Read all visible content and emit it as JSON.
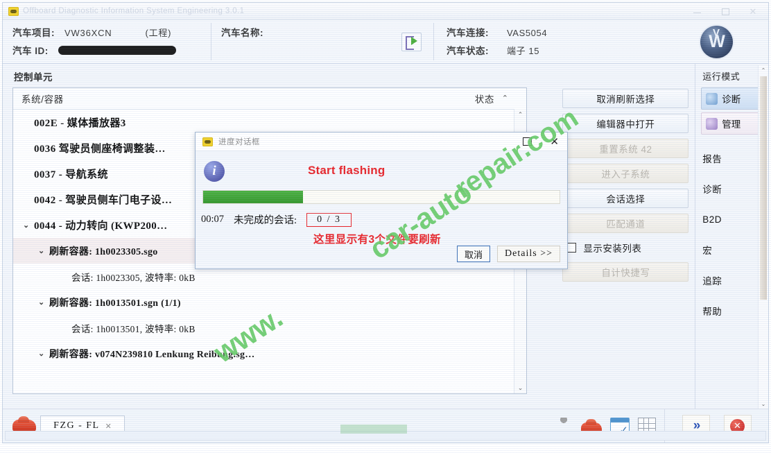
{
  "window": {
    "title": "Offboard Diagnostic Information System Engineering  3.0.1",
    "minimize": "–",
    "maximize": "□",
    "close": "✕"
  },
  "header": {
    "project_label": "汽车项目:",
    "project_value": "VW36XCN",
    "project_mode": "(工程)",
    "id_label": "汽车 ID:",
    "id_value": "",
    "name_label": "汽车名称:",
    "name_value": "",
    "connection_label": "汽车连接:",
    "connection_value": "VAS5054",
    "state_label": "汽车状态:",
    "state_value": "端子 15",
    "brand_logo": "vw-logo"
  },
  "main": {
    "section_title": "控制单元",
    "columns": {
      "system": "系统/容器",
      "status": "状态",
      "sort": "⌃"
    },
    "tree": [
      {
        "level": 1,
        "caret": "",
        "text": "002E - 媒体播放器3",
        "selected": false
      },
      {
        "level": 1,
        "caret": "",
        "text": "0036    驾驶员侧座椅调整装…",
        "selected": false
      },
      {
        "level": 1,
        "caret": "",
        "text": "0037 - 导航系统",
        "selected": false
      },
      {
        "level": 1,
        "caret": "",
        "text": "0042 - 驾驶员侧车门电子设…",
        "selected": false
      },
      {
        "level": 1,
        "caret": "⌄",
        "text": "0044 - 动力转向  (KWP200…",
        "selected": false
      },
      {
        "level": 2,
        "caret": "⌄",
        "text": "刷新容器: 1h0023305.sgo",
        "selected": true
      },
      {
        "level": 3,
        "caret": "",
        "text": "会话: 1h0023305, 波特率: 0kB",
        "selected": false
      },
      {
        "level": 2,
        "caret": "⌄",
        "text": "刷新容器: 1h0013501.sgn (1/1)",
        "selected": false
      },
      {
        "level": 3,
        "caret": "",
        "text": "会话: 1h0013501, 波特率: 0kB",
        "selected": false
      },
      {
        "level": 2,
        "caret": "⌄",
        "text": "刷新容器: v074N239810   Lenkung Reibung.sg…",
        "selected": false
      }
    ],
    "scroll": {
      "up": "⌃",
      "down": "⌄"
    }
  },
  "actions": {
    "buttons": [
      {
        "label": "取消刷新选择",
        "disabled": false
      },
      {
        "label": "编辑器中打开",
        "disabled": false
      },
      {
        "label": "重置系统 42",
        "disabled": true
      },
      {
        "label": "进入子系统",
        "disabled": true
      },
      {
        "label": "会话选择",
        "disabled": false
      },
      {
        "label": "匹配通道",
        "disabled": true
      }
    ],
    "checkbox": {
      "label": "显示安装列表",
      "checked": false
    },
    "bottom_button": {
      "label": "自计快捷写",
      "disabled": true
    }
  },
  "sidebar": {
    "mode_header": {
      "label": "运行模式",
      "chevron": "⌃"
    },
    "mode_buttons": [
      {
        "label": "诊断",
        "icon": "diagnosis-icon",
        "active": true
      },
      {
        "label": "管理",
        "icon": "admin-icon",
        "active": false
      }
    ],
    "items": [
      {
        "label": "报告",
        "chevron": "⌄"
      },
      {
        "label": "诊断",
        "chevron": "⌄"
      },
      {
        "label": "B2D",
        "chevron": "⌄"
      },
      {
        "label": "宏",
        "chevron": "⌄"
      },
      {
        "label": "追踪",
        "chevron": "⌄"
      },
      {
        "label": "帮助",
        "chevron": "⌄"
      }
    ],
    "scroll": {
      "up": "⌃",
      "down": "⌄"
    }
  },
  "dialog": {
    "title": "进度对话框",
    "maximize": "□",
    "close": "✕",
    "annotation_en": "Start flashing",
    "annotation_cn": "这里显示有3个文件要刷新",
    "progress_percent": 28,
    "elapsed": "00:07",
    "progress_label": "未完成的会话:",
    "progress_count": "0 / 3",
    "cancel_button": "取消",
    "details_button": "Details >>"
  },
  "footer": {
    "tab": {
      "label": "FZG - FL",
      "close": "✕",
      "icon": "car-icon"
    },
    "tools": [
      {
        "name": "puzzle-icon"
      },
      {
        "name": "car-icon"
      },
      {
        "name": "window-check-icon"
      },
      {
        "name": "grid-icon"
      }
    ],
    "next_button": "»",
    "stop_button": "✕"
  },
  "watermark": {
    "line1": "www.",
    "line2": "car-auto",
    "line3": "repair.com"
  },
  "colors": {
    "accent_blue": "#2a52b5",
    "progress_green": "#4cb142",
    "annotation_red": "#e8262b",
    "watermark_green": "#56c556"
  }
}
